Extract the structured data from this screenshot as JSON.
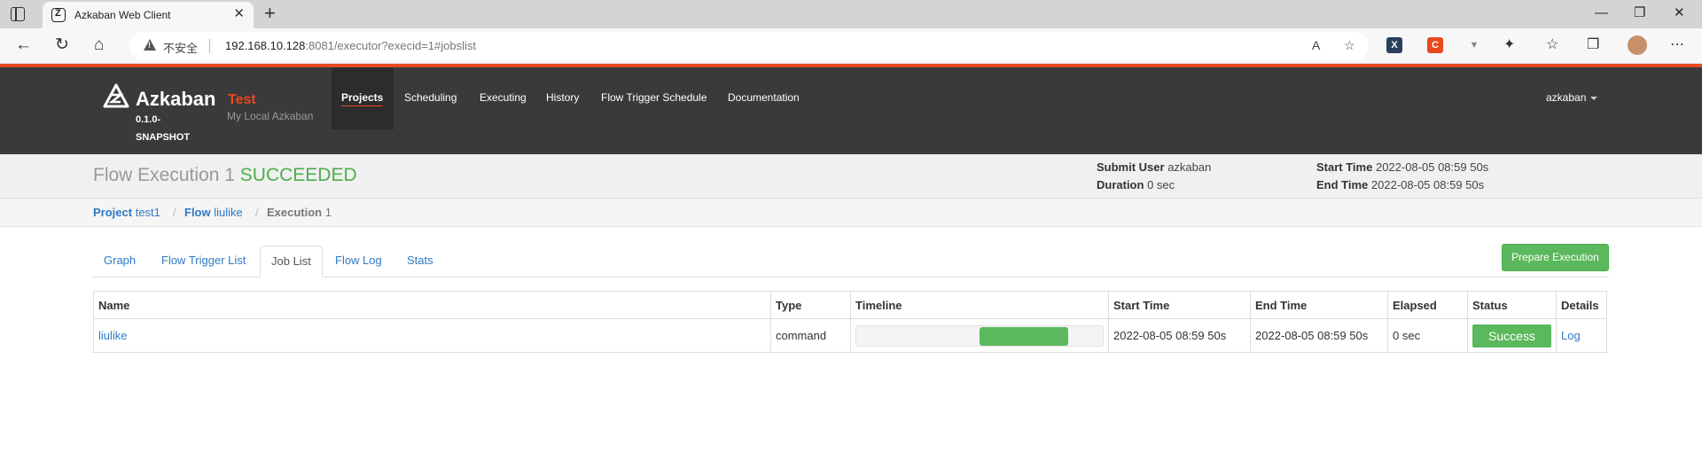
{
  "browser": {
    "tab_title": "Azkaban Web Client",
    "tab_close": "✕",
    "new_tab": "+",
    "not_secure": "不安全",
    "url_host": "192.168.10.128",
    "url_rest": ":8081/executor?execid=1#jobslist",
    "window_controls": [
      "—",
      "❐",
      "✕"
    ],
    "extensions": [
      {
        "name": "x-extension",
        "label": "X",
        "color": "#2a3f5a"
      },
      {
        "name": "c-extension",
        "label": "C",
        "color": "#e8491d"
      },
      {
        "name": "v-extension",
        "label": "▼",
        "color": "#888888"
      }
    ]
  },
  "navbar": {
    "brand": "Azkaban",
    "version": "0.1.0-SNAPSHOT",
    "env_name": "Test",
    "env_desc": "My Local Azkaban",
    "links": [
      "Projects",
      "Scheduling",
      "Executing",
      "History",
      "Flow Trigger Schedule",
      "Documentation"
    ],
    "active_link": "Projects",
    "user": "azkaban",
    "accent": "#e8491d"
  },
  "header": {
    "title_prefix": "Flow Execution 1",
    "status": "SUCCEEDED",
    "submit_user_label": "Submit User",
    "submit_user": "azkaban",
    "duration_label": "Duration",
    "duration": "0 sec",
    "start_time_label": "Start Time",
    "start_time": "2022-08-05 08:59 50s",
    "end_time_label": "End Time",
    "end_time": "2022-08-05 08:59 50s"
  },
  "breadcrumb": {
    "project_label": "Project",
    "project": "test1",
    "flow_label": "Flow",
    "flow": "liulike",
    "execution_label": "Execution",
    "execution": "1",
    "separator": "/"
  },
  "tabs": [
    "Graph",
    "Flow Trigger List",
    "Job List",
    "Flow Log",
    "Stats"
  ],
  "active_tab": "Job List",
  "prepare_button": "Prepare Execution",
  "table": {
    "columns": [
      "Name",
      "Type",
      "Timeline",
      "Start Time",
      "End Time",
      "Elapsed",
      "Status",
      "Details"
    ],
    "rows": [
      {
        "name": "liulike",
        "type": "command",
        "timeline": {
          "start_fraction": 0.5,
          "end_fraction": 0.86
        },
        "start_time": "2022-08-05 08:59 50s",
        "end_time": "2022-08-05 08:59 50s",
        "elapsed": "0 sec",
        "status": "Success",
        "details": "Log"
      }
    ]
  },
  "colors": {
    "success": "#5cb85c",
    "link": "#3079c6",
    "navbar_bg": "#3a3a3a"
  }
}
